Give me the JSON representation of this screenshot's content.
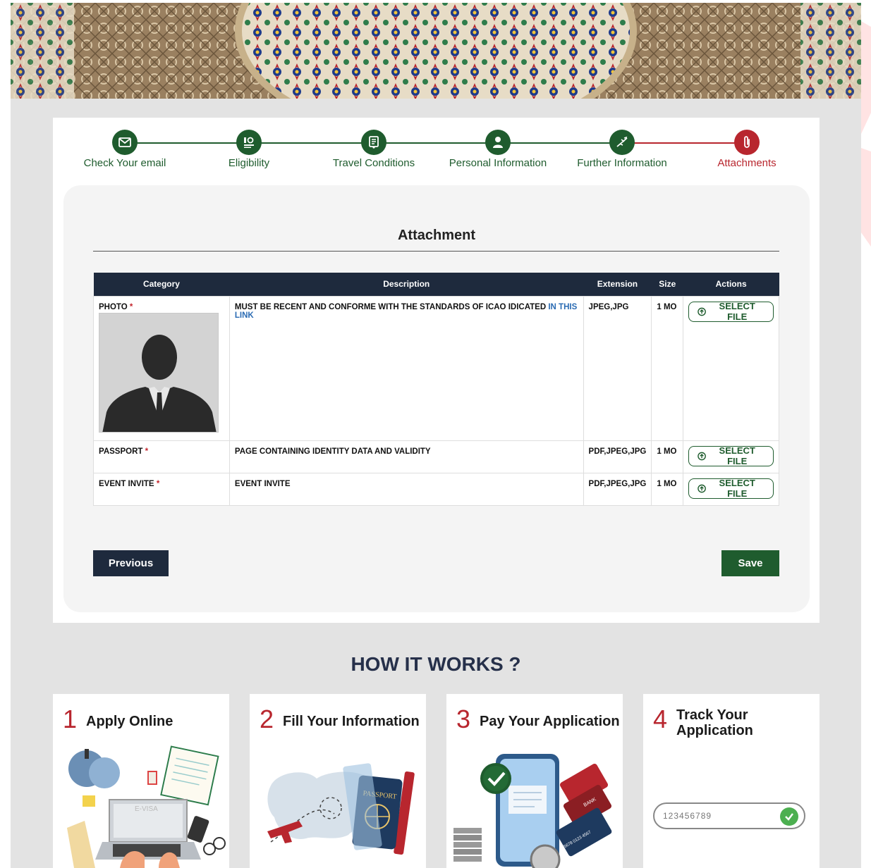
{
  "colors": {
    "primary_green": "#1f5c2e",
    "accent_red": "#b8262e",
    "navy": "#1e2a3d",
    "link_blue": "#2a6bb3"
  },
  "steps": [
    {
      "label": "Check Your email",
      "icon": "envelope-icon",
      "state": "done"
    },
    {
      "label": "Eligibility",
      "icon": "eligibility-icon",
      "state": "done"
    },
    {
      "label": "Travel Conditions",
      "icon": "document-icon",
      "state": "done"
    },
    {
      "label": "Personal Information",
      "icon": "person-icon",
      "state": "done"
    },
    {
      "label": "Further Information",
      "icon": "plane-icon",
      "state": "done"
    },
    {
      "label": "Attachments",
      "icon": "paperclip-icon",
      "state": "active"
    }
  ],
  "attachment": {
    "title": "Attachment",
    "columns": [
      "Category",
      "Description",
      "Extension",
      "Size",
      "Actions"
    ],
    "rows": [
      {
        "category": "PHOTO",
        "required_mark": "*",
        "description": "MUST BE RECENT AND CONFORME WITH THE STANDARDS OF ICAO IDICATED",
        "link_text": "IN THIS LINK",
        "extension": "JPEG,JPG",
        "size": "1 MO",
        "action": "SELECT FILE"
      },
      {
        "category": "PASSPORT",
        "required_mark": "*",
        "description": "PAGE CONTAINING IDENTITY DATA AND VALIDITY",
        "extension": "PDF,JPEG,JPG",
        "size": "1 MO",
        "action": "SELECT FILE"
      },
      {
        "category": "EVENT INVITE",
        "required_mark": "*",
        "description": "EVENT INVITE",
        "extension": "PDF,JPEG,JPG",
        "size": "1 MO",
        "action": "SELECT FILE"
      }
    ],
    "previous_label": "Previous",
    "save_label": "Save"
  },
  "how_it_works": {
    "title": "HOW IT WORKS ?",
    "cards": [
      {
        "number": "1",
        "title": "Apply Online"
      },
      {
        "number": "2",
        "title": "Fill Your Information"
      },
      {
        "number": "3",
        "title": "Pay Your Application"
      },
      {
        "number": "4",
        "title": "Track Your Application",
        "illus_input_text": "123456789",
        "illus_ribbon_text": "E-VISA"
      }
    ],
    "illustration_texts": {
      "ribbon": "E-VISA",
      "passport": "PASSPORT",
      "bank": "BANK",
      "card_number": "5678 0123 4567"
    }
  }
}
